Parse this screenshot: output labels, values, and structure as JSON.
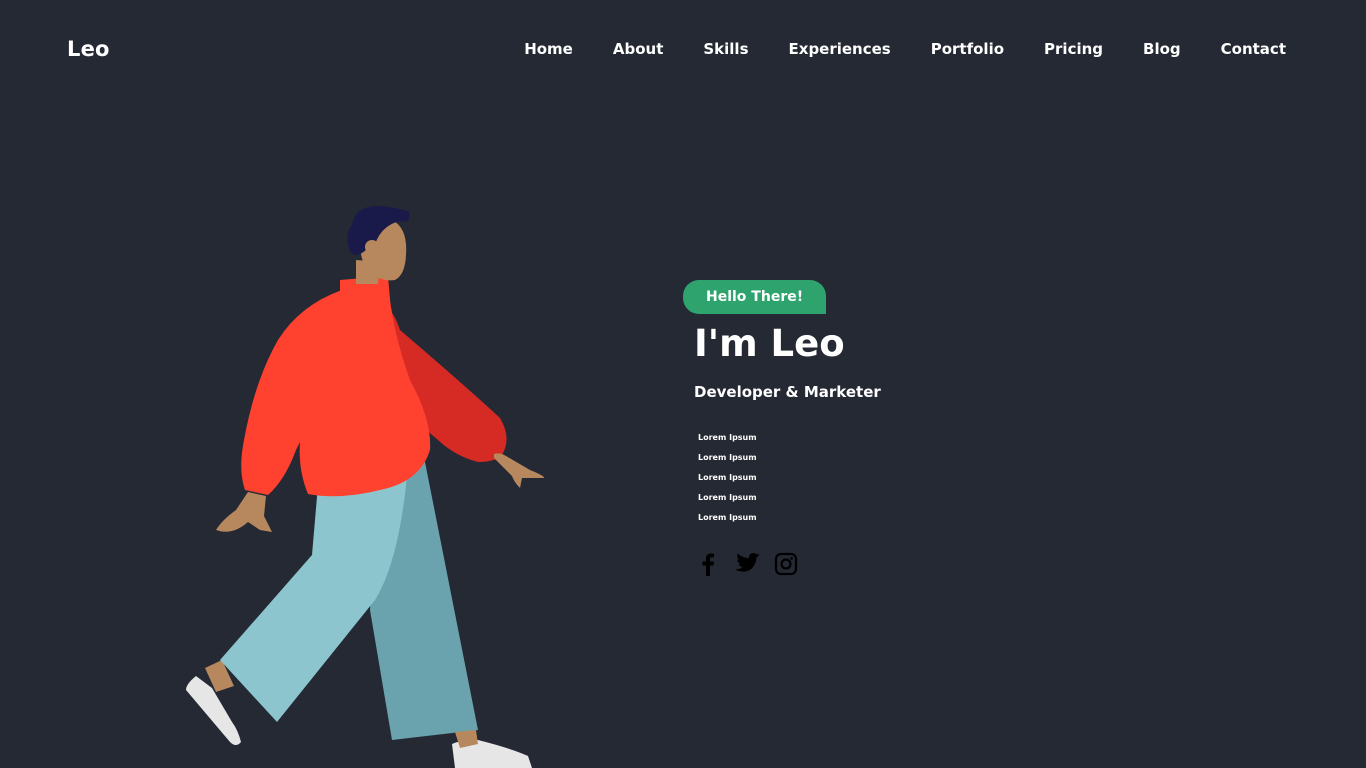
{
  "brand": {
    "logo": "Leo"
  },
  "nav": {
    "items": [
      "Home",
      "About",
      "Skills",
      "Experiences",
      "Portfolio",
      "Pricing",
      "Blog",
      "Contact"
    ]
  },
  "hero": {
    "badge": "Hello There!",
    "title": "I'm Leo",
    "subtitle": "Developer & Marketer",
    "lines": [
      "Lorem Ipsum",
      "Lorem Ipsum",
      "Lorem Ipsum",
      "Lorem Ipsum",
      "Lorem Ipsum"
    ]
  },
  "social": {
    "icons": [
      "facebook-icon",
      "twitter-icon",
      "instagram-icon"
    ]
  },
  "colors": {
    "background": "#242933",
    "accent": "#2ea36e",
    "text": "#ffffff",
    "icon": "#000000"
  }
}
